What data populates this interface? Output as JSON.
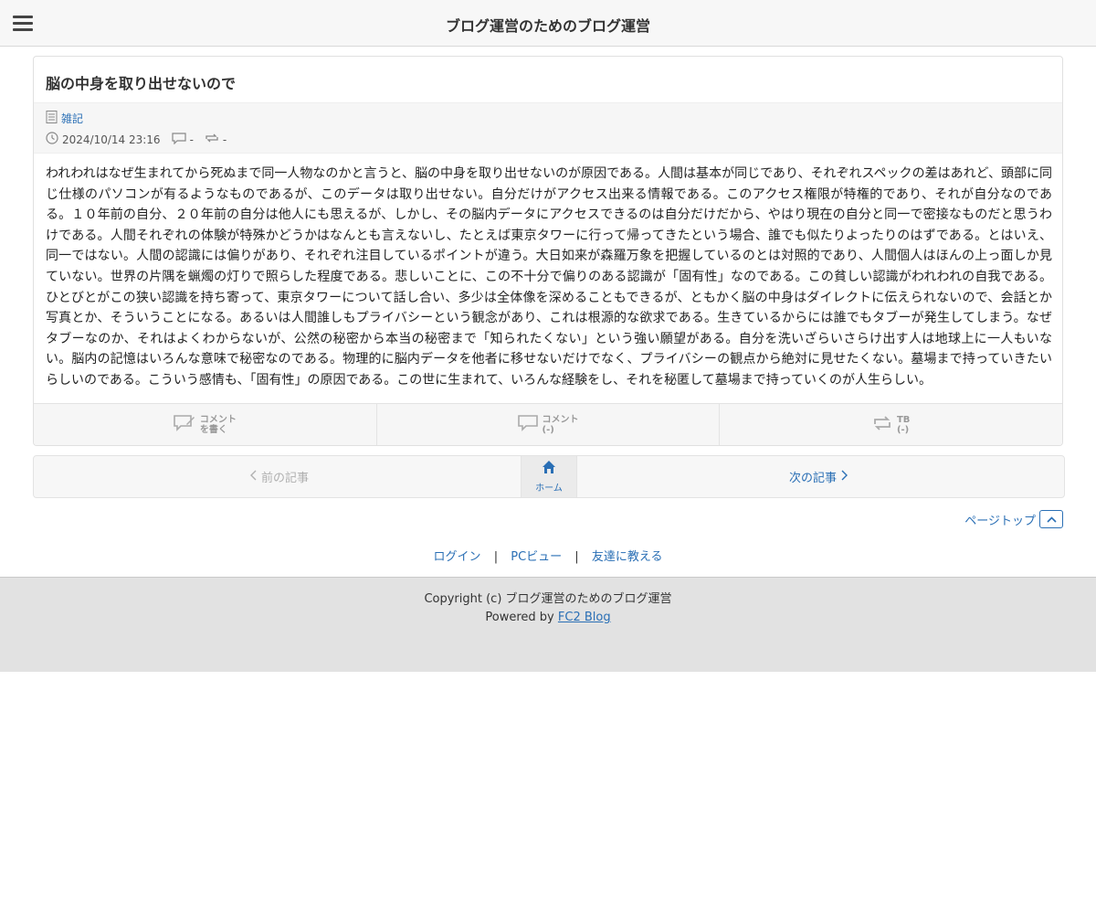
{
  "header": {
    "site_title": "ブログ運営のためのブログ運営",
    "menu_icon": "hamburger-menu-icon"
  },
  "article": {
    "title": "脳の中身を取り出せないので",
    "category": "雑記",
    "datetime": "2024/10/14 23:16",
    "comment_count": "-",
    "trackback_count": "-",
    "body": "われわれはなぜ生まれてから死ぬまで同一人物なのかと言うと、脳の中身を取り出せないのが原因である。人間は基本が同じであり、それぞれスペックの差はあれど、頭部に同じ仕様のパソコンが有るようなものであるが、このデータは取り出せない。自分だけがアクセス出来る情報である。このアクセス権限が特権的であり、それが自分なのである。１０年前の自分、２０年前の自分は他人にも思えるが、しかし、その脳内データにアクセスできるのは自分だけだから、やはり現在の自分と同一で密接なものだと思うわけである。人間それぞれの体験が特殊かどうかはなんとも言えないし、たとえば東京タワーに行って帰ってきたという場合、誰でも似たりよったりのはずである。とはいえ、同一ではない。人間の認識には偏りがあり、それぞれ注目しているポイントが違う。大日如来が森羅万象を把握しているのとは対照的であり、人間個人はほんの上っ面しか見ていない。世界の片隅を蝋燭の灯りで照らした程度である。悲しいことに、この不十分で偏りのある認識が「固有性」なのである。この貧しい認識がわれわれの自我である。ひとびとがこの狭い認識を持ち寄って、東京タワーについて話し合い、多少は全体像を深めることもできるが、ともかく脳の中身はダイレクトに伝えられないので、会話とか写真とか、そういうことになる。あるいは人間誰しもプライバシーという観念があり、これは根源的な欲求である。生きているからには誰でもタブーが発生してしまう。なぜタブーなのか、それはよくわからないが、公然の秘密から本当の秘密まで「知られたくない」という強い願望がある。自分を洗いざらいさらけ出す人は地球上に一人もいない。脳内の記憶はいろんな意味で秘密なのである。物理的に脳内データを他者に移せないだけでなく、プライバシーの観点から絶対に見せたくない。墓場まで持っていきたいらしいのである。こういう感情も、「固有性」の原因である。この世に生まれて、いろんな経験をし、それを秘匿して墓場まで持っていくのが人生らしい。",
    "actions": [
      {
        "icon": "write-comment-icon",
        "line1": "コメント",
        "line2": "を書く"
      },
      {
        "icon": "comment-icon",
        "line1": "コメント",
        "line2": "(-)"
      },
      {
        "icon": "trackback-icon",
        "line1": "TB",
        "line2": "(-)"
      }
    ]
  },
  "pager": {
    "prev_label": "前の記事",
    "home_label": "ホーム",
    "next_label": "次の記事"
  },
  "pagetop": {
    "label": "ページトップ"
  },
  "footer_links": {
    "login": "ログイン",
    "pc_view": "PCビュー",
    "tell_friend": "友達に教える",
    "separator": "|"
  },
  "footer": {
    "copyright": "Copyright (c) ブログ運営のためのブログ運営",
    "powered_prefix": "Powered by",
    "powered_link": "FC2 Blog"
  },
  "colors": {
    "link": "#2a6fb5",
    "header_bg": "#f7f7f7",
    "footer_bg": "#e2e2e2"
  }
}
